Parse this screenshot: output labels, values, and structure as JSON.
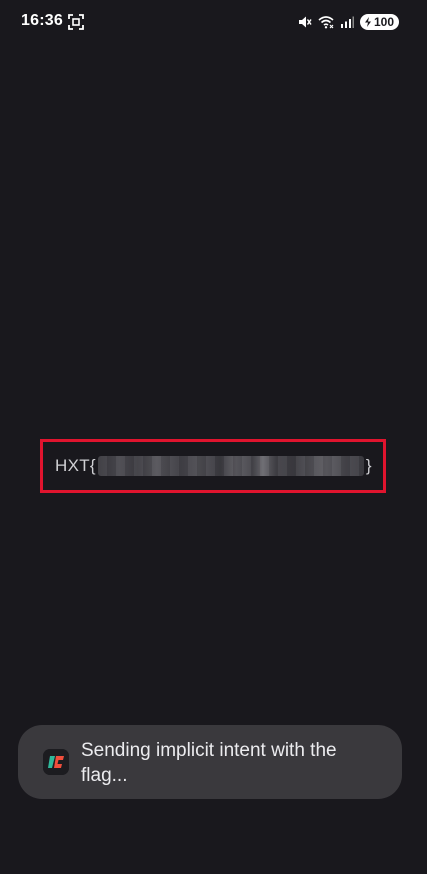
{
  "status_bar": {
    "time": "16:36",
    "battery_level": "100",
    "icons": [
      "screenshot-icon",
      "mute-icon",
      "wifi-icon",
      "signal-icon",
      "battery-icon"
    ]
  },
  "flag_display": {
    "prefix": "HXT{",
    "suffix": "}",
    "highlight_color": "#e0142e"
  },
  "toast": {
    "app_icon": "app-logo-icon",
    "message": "Sending implicit intent with the flag..."
  },
  "colors": {
    "background": "#19181d",
    "toast_background": "#3a393d"
  }
}
